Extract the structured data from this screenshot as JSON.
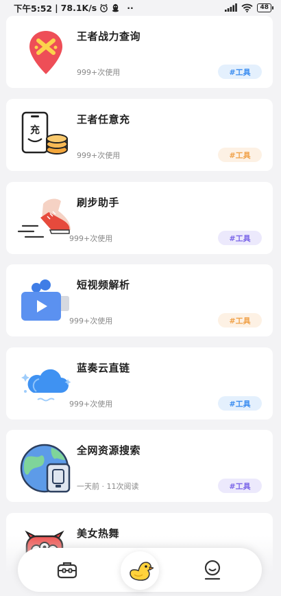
{
  "statusbar": {
    "time": "下午5:52",
    "separator": "|",
    "speed": "78.1K/s",
    "dots": "··",
    "battery": "48"
  },
  "cards": [
    {
      "title": "王者战力查询",
      "meta": "999+次使用",
      "tag": "#工具",
      "tag_color": "#3b8df0",
      "tag_bg": "#e4f0fd",
      "icon": "map-pin-icon"
    },
    {
      "title": "王者任意充",
      "meta": "999+次使用",
      "tag": "#工具",
      "tag_color": "#f0a24a",
      "tag_bg": "#fdf1e4",
      "icon": "phone-coin-icon",
      "phone_text": "充"
    },
    {
      "title": "刷步助手",
      "meta": "999+次使用",
      "tag": "#工具",
      "tag_color": "#7b66e8",
      "tag_bg": "#ece9fc",
      "icon": "running-shoe-icon"
    },
    {
      "title": "短视频解析",
      "meta": "999+次使用",
      "tag": "#工具",
      "tag_color": "#f0a24a",
      "tag_bg": "#fdf1e4",
      "icon": "video-camera-icon"
    },
    {
      "title": "蓝奏云直链",
      "meta": "999+次使用",
      "tag": "#工具",
      "tag_color": "#3b8df0",
      "tag_bg": "#e4f0fd",
      "icon": "cloud-icon"
    },
    {
      "title": "全网资源搜索",
      "meta": "一天前 · 11次阅读",
      "tag": "#工具",
      "tag_color": "#7b66e8",
      "tag_bg": "#ece9fc",
      "icon": "globe-drive-icon"
    },
    {
      "title": "美女热舞",
      "meta": "",
      "tag": "",
      "icon": "red-monster-icon"
    }
  ],
  "tabbar": {
    "items": [
      {
        "name": "toolbox-tab",
        "icon": "toolbox-icon"
      },
      {
        "name": "home-tab",
        "icon": "duck-icon"
      },
      {
        "name": "profile-tab",
        "icon": "user-icon"
      }
    ]
  }
}
